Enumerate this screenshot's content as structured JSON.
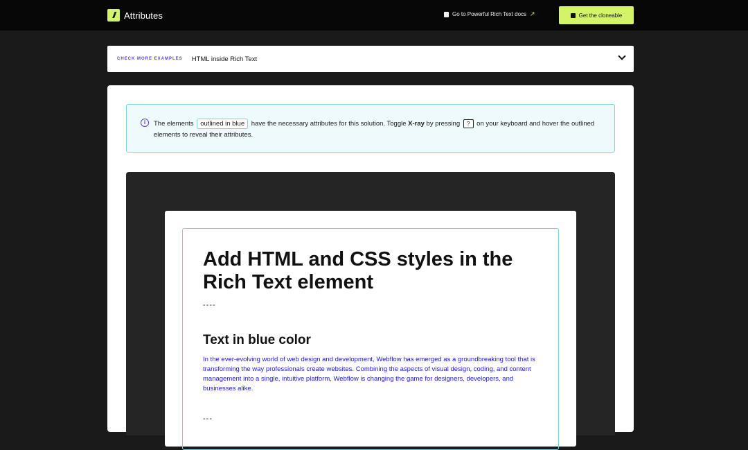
{
  "brand": {
    "logo_glyph": "//",
    "name": "Attributes"
  },
  "nav": {
    "docs_label": "Go to Powerful Rich Text docs",
    "docs_arrow": "↗",
    "cta_label": "Get the cloneable"
  },
  "examples": {
    "eyebrow": "CHECK MORE EXAMPLES",
    "selected": "HTML inside Rich Text"
  },
  "notice": {
    "info_glyph": "i",
    "text_1": "The elements",
    "chip": "outlined in blue",
    "text_2": "have the necessary attributes for this solution. Toggle",
    "xray": "X-ray",
    "text_3": "by pressing",
    "key": "?",
    "text_4": "on your keyboard and hover the outlined elements to reveal their attributes."
  },
  "content": {
    "heading": "Add HTML and CSS styles in the Rich Text element",
    "separator_1": "----",
    "subheading": "Text in blue color",
    "paragraph": "In the ever-evolving world of web design and development, Webflow has emerged as a groundbreaking tool that is transforming the way professionals create websites. Combining the aspects of visual design, coding, and content management into a single, intuitive platform, Webflow is changing the game for designers, developers, and businesses alike.",
    "separator_2": "---"
  },
  "colors": {
    "accent": "#d3f36b",
    "eyebrow": "#5b3bd6",
    "outline": "#7ad3e2",
    "blue_text": "#2020d0"
  }
}
